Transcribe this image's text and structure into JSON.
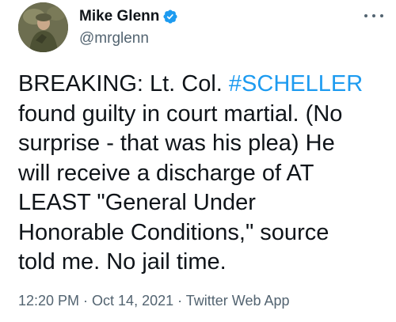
{
  "tweet": {
    "author": {
      "display_name": "Mike Glenn",
      "handle": "@mrglenn",
      "verified": true
    },
    "text_parts": {
      "lead": "BREAKING: Lt. Col. ",
      "hashtag": "#SCHELLER",
      "rest": "\nfound guilty in court martial. (No\nsurprise - that was his plea) He\nwill receive a discharge of AT\nLEAST \"General Under\nHonorable Conditions,\" source\ntold me. No jail time."
    },
    "meta": {
      "text": "12:20 PM · Oct 14, 2021 · Twitter Web App"
    },
    "colors": {
      "hashtag": "#1d9bf0",
      "verified_badge": "#1d9bf0",
      "secondary_text": "#536471"
    },
    "icons": {
      "verified": "verified-badge-icon",
      "more": "more-options-icon"
    }
  }
}
